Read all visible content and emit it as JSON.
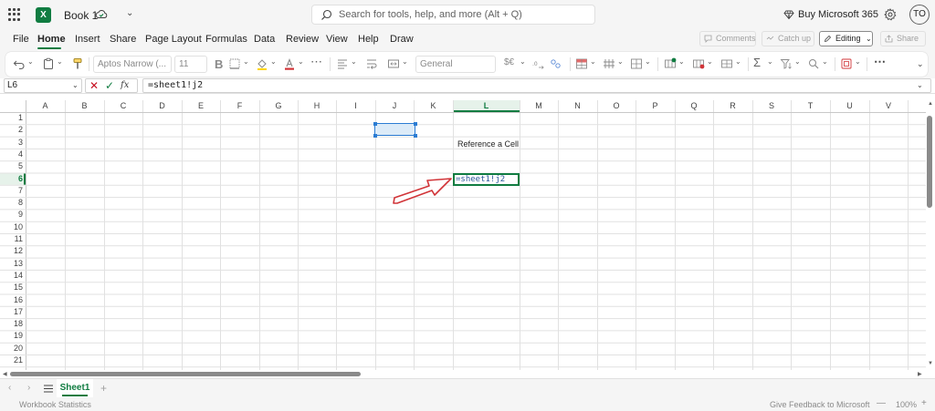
{
  "app": {
    "doc_title": "Book 1",
    "search_placeholder": "Search for tools, help, and more (Alt + Q)",
    "buy_label": "Buy Microsoft 365",
    "avatar_initials": "TO",
    "logo_letter": "X"
  },
  "menu": {
    "tabs": [
      "File",
      "Home",
      "Insert",
      "Share",
      "Page Layout",
      "Formulas",
      "Data",
      "Review",
      "View",
      "Help",
      "Draw"
    ],
    "active_tab": "Home",
    "comments_label": "Comments",
    "catchup_label": "Catch up",
    "editing_label": "Editing",
    "share_label": "Share"
  },
  "ribbon": {
    "font_name": "Aptos Narrow (...",
    "font_size": "11",
    "bold_label": "B",
    "number_format": "General",
    "currency_symbol": "$€",
    "sum_symbol": "Σ"
  },
  "formula_bar": {
    "name_box": "L6",
    "fx_label": "fx",
    "formula": "=sheet1!j2"
  },
  "grid": {
    "columns": [
      "A",
      "B",
      "C",
      "D",
      "E",
      "F",
      "G",
      "H",
      "I",
      "J",
      "K",
      "L",
      "M",
      "N",
      "O",
      "P",
      "Q",
      "R",
      "S",
      "T",
      "U",
      "V"
    ],
    "rows": [
      "1",
      "2",
      "3",
      "4",
      "5",
      "6",
      "7",
      "8",
      "9",
      "10",
      "11",
      "12",
      "13",
      "14",
      "15",
      "16",
      "17",
      "18",
      "19",
      "20",
      "21"
    ],
    "active_cell": "L6",
    "referenced_cell": "J2",
    "cells": {
      "L3": "Reference a Cell",
      "L6": "=sheet1!j2"
    },
    "annotation_arrow_color": "#d13438"
  },
  "sheets": {
    "tabs": [
      "Sheet1"
    ],
    "active": "Sheet1"
  },
  "status": {
    "left": "Workbook Statistics",
    "feedback": "Give Feedback to Microsoft",
    "zoom": "100%",
    "zoom_minus": "—",
    "zoom_plus": "+"
  },
  "colors": {
    "accent": "#107c41",
    "reference": "#2b7cd3",
    "reference_fill": "#dcebf8",
    "chrome": "#f5f5f5"
  }
}
